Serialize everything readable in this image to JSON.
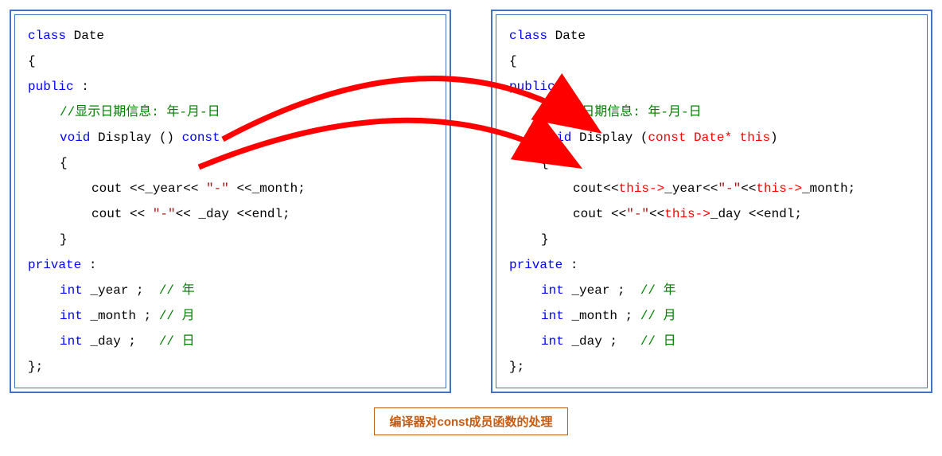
{
  "left": {
    "l1_kw": "class",
    "l1_name": " Date",
    "l2": "{",
    "l3_kw": "public",
    "l3_rest": " :",
    "l4_comment": "//显示日期信息: 年-月-日",
    "l5_kw": "void",
    "l5_name": " Display () ",
    "l5_const": "const",
    "l6": "{",
    "l7a": "cout <<_year<< ",
    "l7b": "\"-\"",
    "l7c": " <<_month;",
    "l8a": "cout << ",
    "l8b": "\"-\"",
    "l8c": "<< _day <<endl;",
    "l9": "}",
    "l10_kw": "private",
    "l10_rest": " :",
    "l11_kw": "int",
    "l11_name": " _year ;  ",
    "l11_comment": "// 年",
    "l12_kw": "int",
    "l12_name": " _month ; ",
    "l12_comment": "// 月",
    "l13_kw": "int",
    "l13_name": " _day ;   ",
    "l13_comment": "// 日",
    "l14": "};"
  },
  "right": {
    "l1_kw": "class",
    "l1_name": " Date",
    "l2": "{",
    "l3_kw": "public",
    "l3_rest": " :",
    "l4_comment": "//显示日期信息: 年-月-日",
    "l5_kw": "void",
    "l5_name": " Display (",
    "l5_param": "const Date* this",
    "l5_close": ")",
    "l6": "{",
    "l7a": "cout<<",
    "l7b": "this->",
    "l7c": "_year<<",
    "l7d": "\"-\"",
    "l7e": "<<",
    "l7f": "this->",
    "l7g": "_month;",
    "l8a": "cout <<",
    "l8b": "\"-\"",
    "l8c": "<<",
    "l8d": "this->",
    "l8e": "_day <<endl;",
    "l9": "}",
    "l10_kw": "private",
    "l10_rest": " :",
    "l11_kw": "int",
    "l11_name": " _year ;  ",
    "l11_comment": "// 年",
    "l12_kw": "int",
    "l12_name": " _month ; ",
    "l12_comment": "// 月",
    "l13_kw": "int",
    "l13_name": " _day ;   ",
    "l13_comment": "// 日",
    "l14": "};"
  },
  "caption": "编译器对const成员函数的处理"
}
